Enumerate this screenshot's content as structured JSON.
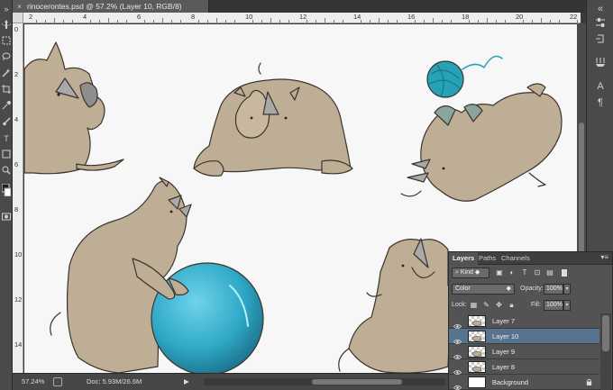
{
  "document_tab": {
    "close_glyph": "×",
    "title": "rinocerontes.psd @ 57.2% (Layer 10, RGB/8)"
  },
  "ruler_top_labels": [
    "2",
    "4",
    "6",
    "8",
    "10",
    "12",
    "14",
    "16",
    "18",
    "20",
    "22"
  ],
  "ruler_left_labels": [
    "0",
    "2",
    "4",
    "6",
    "8",
    "10",
    "12",
    "14"
  ],
  "status_bar": {
    "zoom": "57.24%",
    "doc_info": "Doc: 5.93M/26.6M",
    "arrow": "▶"
  },
  "layers_panel": {
    "tabs": [
      "Layers",
      "Paths",
      "Channels"
    ],
    "menu_glyph": "▾≡",
    "filter_kind": "Kind",
    "blend_mode": "Color",
    "opacity_label": "Opacity:",
    "opacity_value": "100%",
    "lock_label": "Lock:",
    "fill_label": "Fill:",
    "fill_value": "100%",
    "layers": [
      {
        "name": "Layer 7",
        "selected": false,
        "visible": true,
        "locked": false
      },
      {
        "name": "Layer 10",
        "selected": true,
        "visible": true,
        "locked": false
      },
      {
        "name": "Layer 9",
        "selected": false,
        "visible": true,
        "locked": false
      },
      {
        "name": "Layer 8",
        "selected": false,
        "visible": true,
        "locked": false
      },
      {
        "name": "Background",
        "selected": false,
        "visible": true,
        "locked": true
      }
    ]
  },
  "colors": {
    "canvas_bg": "#f7f7f7",
    "rhino_skin": "#bfae96",
    "rhino_outline": "#3b342c",
    "ball_blue": "#2fa9c7",
    "yarn_teal": "#27a1b5",
    "selected_layer": "#58738f"
  }
}
